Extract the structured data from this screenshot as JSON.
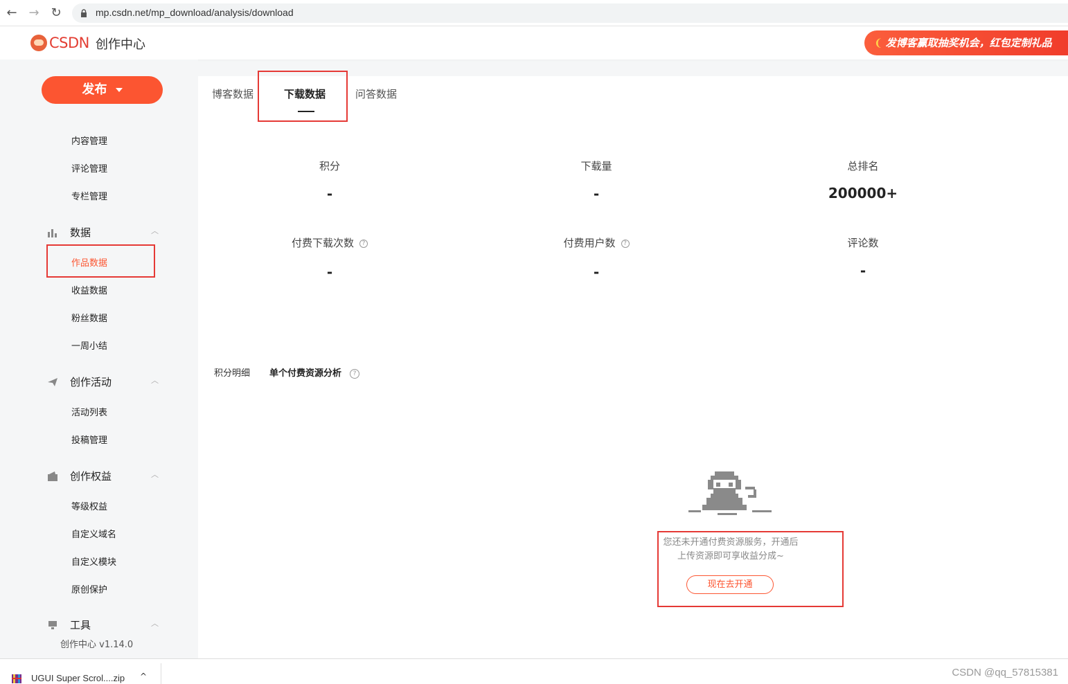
{
  "browser": {
    "url": "mp.csdn.net/mp_download/analysis/download",
    "back_icon": "←",
    "forward_icon": "→",
    "reload_icon": "↻"
  },
  "header": {
    "brand": "CSDN",
    "title": "创作中心",
    "promo_text": "发博客赢取抽奖机会，红包定制礼品"
  },
  "sidebar": {
    "publish_label": "发布",
    "items_content": [
      "内容管理",
      "评论管理",
      "专栏管理"
    ],
    "group_data": "数据",
    "items_data": [
      "作品数据",
      "收益数据",
      "粉丝数据",
      "一周小结"
    ],
    "group_activity": "创作活动",
    "items_activity": [
      "活动列表",
      "投稿管理"
    ],
    "group_rights": "创作权益",
    "items_rights": [
      "等级权益",
      "自定义域名",
      "自定义模块",
      "原创保护"
    ],
    "group_tools": "工具",
    "version": "创作中心 v1.14.0"
  },
  "main": {
    "tabs": [
      "博客数据",
      "下载数据",
      "问答数据"
    ],
    "stats": [
      {
        "label": "积分",
        "value": "-"
      },
      {
        "label": "下载量",
        "value": "-"
      },
      {
        "label": "总排名",
        "value": "200000+"
      },
      {
        "label": "付费下载次数",
        "value": "-"
      },
      {
        "label": "付费用户数",
        "value": "-"
      },
      {
        "label": "评论数",
        "value": "-"
      }
    ],
    "help_glyph": "?",
    "subtabs": [
      "积分明细",
      "单个付费资源分析"
    ],
    "empty_line1": "您还未开通付费资源服务，开通后",
    "empty_line2": "上传资源即可享收益分成~",
    "open_button": "现在去开通"
  },
  "download_bar": {
    "file_name": "UGUI Super Scrol....zip",
    "caret": "^",
    "watermark": "CSDN @qq_57815381"
  }
}
